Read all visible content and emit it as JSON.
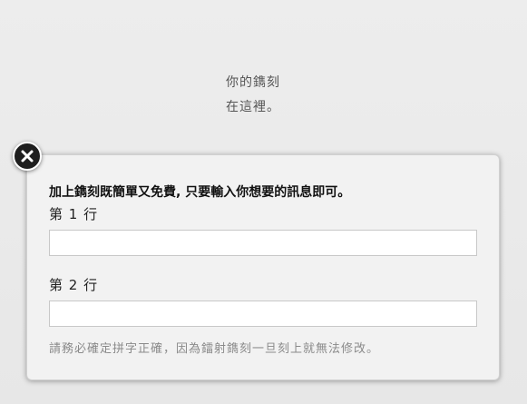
{
  "preview": {
    "line1": "你的鐫刻",
    "line2": "在這裡。"
  },
  "modal": {
    "title": "加上鐫刻既簡單又免費, 只要輸入你想要的訊息即可。",
    "line1_label": "第 1 行",
    "line1_value": "",
    "line2_label": "第 2 行",
    "line2_value": "",
    "hint": "請務必確定拼字正確，因為鐳射鐫刻一旦刻上就無法修改。",
    "close_icon": "close-x-icon"
  }
}
